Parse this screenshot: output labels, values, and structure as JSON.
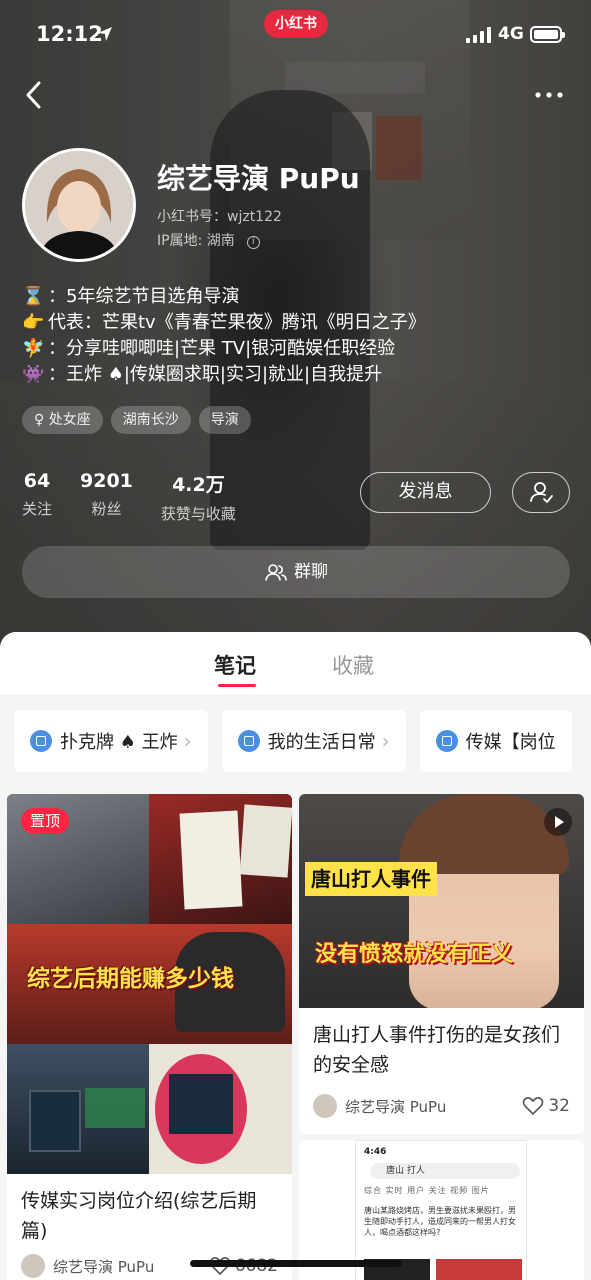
{
  "status_bar": {
    "time": "12:12",
    "network": "4G",
    "app_badge": "小红书"
  },
  "profile": {
    "nickname": "综艺导演 PuPu",
    "id_text": "小红书号：wjzt122",
    "ip_text": "IP属地: 湖南",
    "bio": [
      {
        "emoji": "⌛",
        "text": "：5年综艺节目选角导演"
      },
      {
        "emoji": "👉",
        "text": "代表：芒果tv《青春芒果夜》腾讯《明日之子》"
      },
      {
        "emoji": "🧚",
        "text": "：分享哇唧唧哇|芒果 TV|银河酷娱任职经验"
      },
      {
        "emoji": "👾",
        "text": "：王炸 ♠|传媒圈求职|实习|就业|自我提升"
      }
    ],
    "tags": [
      "♀ 处女座",
      "湖南长沙",
      "导演"
    ],
    "stats": [
      {
        "value": "64",
        "label": "关注"
      },
      {
        "value": "9201",
        "label": "粉丝"
      },
      {
        "value": "4.2万",
        "label": "获赞与收藏"
      }
    ],
    "message_button": "发消息",
    "group_chat_button": "群聊"
  },
  "tabs": {
    "notes": "笔记",
    "favorites": "收藏"
  },
  "collections": [
    "扑克牌 ♠ 王炸",
    "我的生活日常",
    "传媒【岗位"
  ],
  "notes": [
    {
      "badge": "置顶",
      "cover_text": "综艺后期能赚多少钱",
      "title": "传媒实习岗位介绍(综艺后期篇)",
      "author": "综艺导演 PuPu",
      "likes": "6682"
    },
    {
      "cover_text_1": "唐山打人事件",
      "cover_text_2": "没有愤怒就没有正义",
      "title": "唐山打人事件打伤的是女孩们的安全感",
      "author": "综艺导演 PuPu",
      "likes": "32"
    },
    {
      "shot_time": "4:46",
      "shot_search": "唐山 打人",
      "shot_tabs": "综合 实时 用户 关注 视频 图片",
      "shot_text": "唐山某路烧烤店，男生要滋扰未果殴打，男生随即动手打人，造成同来的一帮男人打女人，喝点酒都这样吗?"
    }
  ],
  "colors": {
    "accent": "#ff2442",
    "brand_badge": "#e8283e"
  }
}
